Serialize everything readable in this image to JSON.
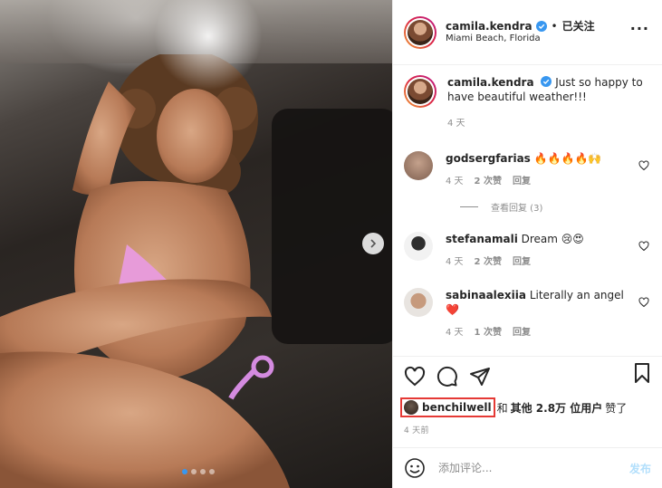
{
  "post": {
    "author": "camila.kendra",
    "follow_status": "已关注",
    "separator": "•",
    "location": "Miami Beach, Florida",
    "more_glyph": "···",
    "caption_author": "camila.kendra",
    "caption_text": "Just so happy to have beautiful weather!!!",
    "caption_time": "4 天"
  },
  "comments": [
    {
      "user": "godsergfarias",
      "text": "🔥🔥🔥🔥🙌",
      "time": "4 天",
      "likes": "2 次赞",
      "reply": "回复",
      "view_replies": "查看回复 (3)"
    },
    {
      "user": "stefanamali",
      "text": "Dream 😢😍",
      "time": "4 天",
      "likes": "2 次赞",
      "reply": "回复"
    },
    {
      "user": "sabinaalexiia",
      "text": "Literally an angel❤️",
      "time": "4 天",
      "likes": "1 次赞",
      "reply": "回复"
    }
  ],
  "likes": {
    "liker": "benchilwell",
    "conj": "和",
    "others": "其他 2.8万 位用户",
    "suffix": "赞了"
  },
  "posted_time": "4 天前",
  "add_comment": {
    "placeholder": "添加评论...",
    "post_label": "发布"
  },
  "carousel": {
    "count": 4,
    "active": 1
  },
  "colors": {
    "accent": "#3897f0",
    "highlight": "#e53935",
    "muted": "#8e8e8e"
  },
  "icons": [
    "verified-icon",
    "more-icon",
    "heart-icon",
    "comment-icon",
    "share-icon",
    "bookmark-icon",
    "emoji-icon",
    "chevron-right-icon"
  ]
}
